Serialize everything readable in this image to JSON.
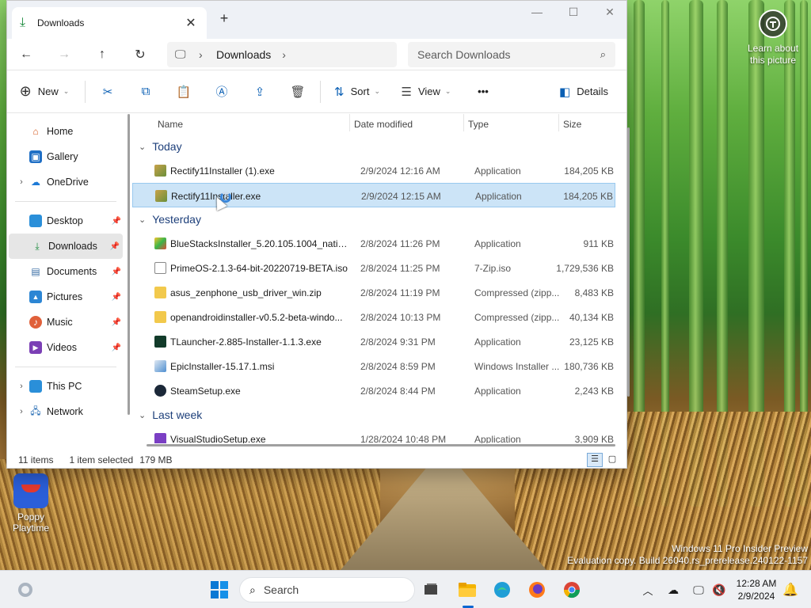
{
  "desktop": {
    "learn_about": "Learn about this picture",
    "icons": [
      {
        "label": "Poppy Playtime"
      }
    ],
    "watermark_line1": "Windows 11 Pro Insider Preview",
    "watermark_line2": "Evaluation copy. Build 26040.rs_prerelease.240122-1157"
  },
  "window": {
    "tab_title": "Downloads",
    "breadcrumb": "Downloads",
    "search_placeholder": "Search Downloads",
    "toolbar": {
      "new_label": "New",
      "sort_label": "Sort",
      "view_label": "View",
      "more_label": "•••",
      "details_label": "Details"
    },
    "sidebar": {
      "items": [
        {
          "label": "Home"
        },
        {
          "label": "Gallery"
        },
        {
          "label": "OneDrive"
        },
        {
          "label": "Desktop"
        },
        {
          "label": "Downloads"
        },
        {
          "label": "Documents"
        },
        {
          "label": "Pictures"
        },
        {
          "label": "Music"
        },
        {
          "label": "Videos"
        },
        {
          "label": "This PC"
        },
        {
          "label": "Network"
        }
      ]
    },
    "columns": {
      "name": "Name",
      "date": "Date modified",
      "type": "Type",
      "size": "Size"
    },
    "groups": [
      {
        "label": "Today",
        "files": [
          {
            "name": "Rectify11Installer (1).exe",
            "date": "2/9/2024 12:16 AM",
            "type": "Application",
            "size": "184,205 KB"
          },
          {
            "name": "Rectify11Installer.exe",
            "date": "2/9/2024 12:15 AM",
            "type": "Application",
            "size": "184,205 KB"
          }
        ]
      },
      {
        "label": "Yesterday",
        "files": [
          {
            "name": "BlueStacksInstaller_5.20.105.1004_native_...",
            "date": "2/8/2024 11:26 PM",
            "type": "Application",
            "size": "911 KB"
          },
          {
            "name": "PrimeOS-2.1.3-64-bit-20220719-BETA.iso",
            "date": "2/8/2024 11:25 PM",
            "type": "7-Zip.iso",
            "size": "1,729,536 KB"
          },
          {
            "name": "asus_zenphone_usb_driver_win.zip",
            "date": "2/8/2024 11:19 PM",
            "type": "Compressed (zipp...",
            "size": "8,483 KB"
          },
          {
            "name": "openandroidinstaller-v0.5.2-beta-windo...",
            "date": "2/8/2024 10:13 PM",
            "type": "Compressed (zipp...",
            "size": "40,134 KB"
          },
          {
            "name": "TLauncher-2.885-Installer-1.1.3.exe",
            "date": "2/8/2024 9:31 PM",
            "type": "Application",
            "size": "23,125 KB"
          },
          {
            "name": "EpicInstaller-15.17.1.msi",
            "date": "2/8/2024 8:59 PM",
            "type": "Windows Installer ...",
            "size": "180,736 KB"
          },
          {
            "name": "SteamSetup.exe",
            "date": "2/8/2024 8:44 PM",
            "type": "Application",
            "size": "2,243 KB"
          }
        ]
      },
      {
        "label": "Last week",
        "files": [
          {
            "name": "VisualStudioSetup.exe",
            "date": "1/28/2024 10:48 PM",
            "type": "Application",
            "size": "3,909 KB"
          }
        ]
      }
    ],
    "status": {
      "items": "11 items",
      "selected": "1 item selected",
      "size": "179 MB"
    }
  },
  "taskbar": {
    "search_label": "Search",
    "time": "12:28 AM",
    "date": "2/9/2024"
  }
}
